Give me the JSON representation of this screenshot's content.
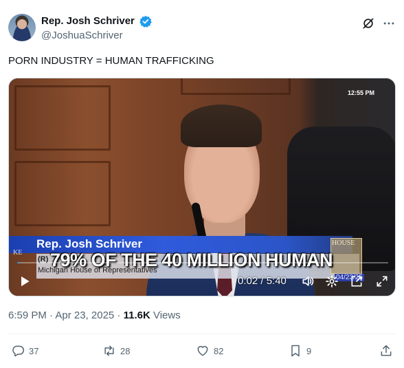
{
  "author": {
    "display_name": "Rep. Josh Schriver",
    "handle": "@JoshuaSchriver",
    "verified_icon": "verified-badge-icon"
  },
  "tweet": {
    "text": "PORN INDUSTRY = HUMAN TRAFFICKING"
  },
  "video": {
    "clock": "12:55 PM",
    "lower_third_name": "Rep. Josh Schriver",
    "lower_third_party": "(R)",
    "lower_third_office": "Michigan House of Representatives",
    "caption": "79% OF THE 40 MILLION HUMAN",
    "side_text": "KE",
    "logo_text": "HOUSE",
    "date_badge": "04/23/25",
    "elapsed": "0:02",
    "duration": "5:40",
    "time_display": "0:02 / 5:40",
    "progress_fraction": 0.006
  },
  "meta": {
    "timestamp": "6:59 PM · Apr 23, 2025 · ",
    "views_count": "11.6K",
    "views_label": " Views"
  },
  "actions": {
    "replies": "37",
    "reposts": "28",
    "likes": "82",
    "bookmarks": "9"
  },
  "colors": {
    "accent": "#1d9bf0",
    "text_primary": "#0f1419",
    "text_secondary": "#536471"
  }
}
